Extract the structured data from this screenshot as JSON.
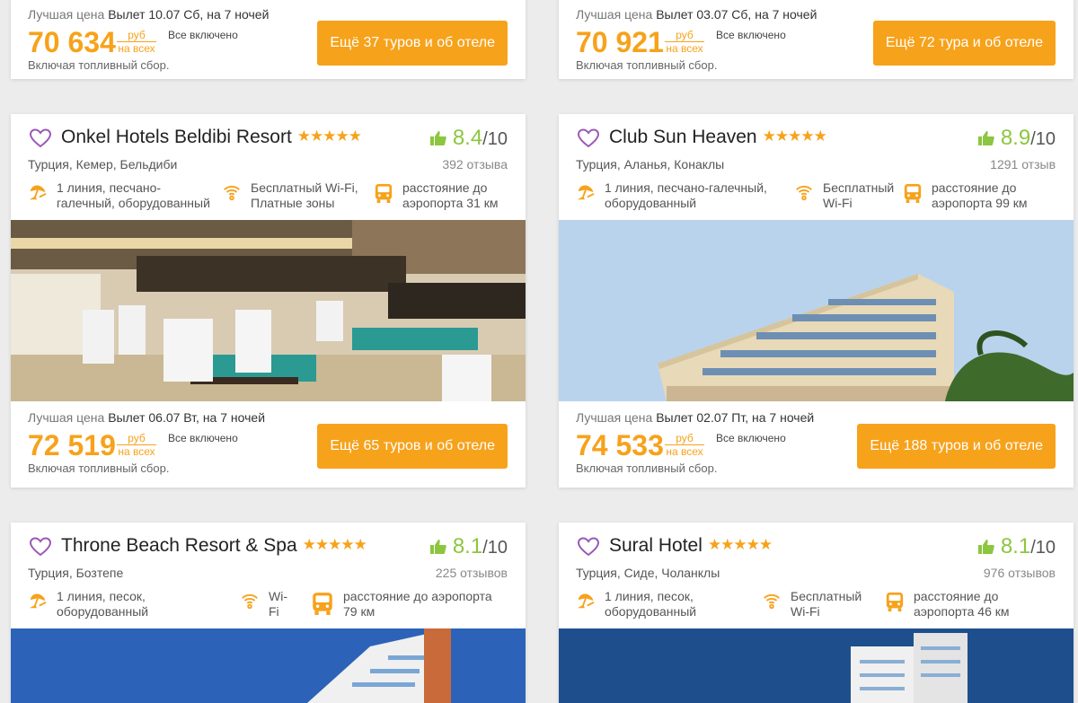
{
  "labels": {
    "best_price": "Лучшая цена",
    "fuel": "Включая топливный сбор.",
    "currency_top": "руб",
    "currency_bottom": "на всех"
  },
  "top_row": [
    {
      "departure": "Вылет 10.07 Сб, на 7 ночей",
      "price": "70 634",
      "meal": "Все включено",
      "tours_btn": "Ещё 37 туров и об отеле"
    },
    {
      "departure": "Вылет 03.07 Сб, на 7 ночей",
      "price": "70 921",
      "meal": "Все включено",
      "tours_btn": "Ещё 72 тура и об отеле"
    }
  ],
  "hotels": [
    {
      "name": "Onkel Hotels Beldibi Resort",
      "stars": "★★★★★",
      "rating": "8.4",
      "rating_max": "/10",
      "location": "Турция, Кемер, Бельдиби",
      "reviews": "392 отзыва",
      "beach": "1 линия, песчано-галечный, оборудованный",
      "wifi": "Бесплатный Wi-Fi, Платные зоны",
      "airport": "расстояние до аэропорта 31 км",
      "departure": "Вылет 06.07 Вт, на 7 ночей",
      "price": "72 519",
      "meal": "Все включено",
      "tours_btn": "Ещё 65 туров и об отеле"
    },
    {
      "name": "Club Sun Heaven",
      "stars": "★★★★★",
      "rating": "8.9",
      "rating_max": "/10",
      "location": "Турция, Аланья, Конаклы",
      "reviews": "1291 отзыв",
      "beach": "1 линия, песчано-галечный, оборудованный",
      "wifi": "Бесплатный Wi-Fi",
      "airport": "расстояние до аэропорта 99 км",
      "departure": "Вылет 02.07 Пт, на 7 ночей",
      "price": "74 533",
      "meal": "Все включено",
      "tours_btn": "Ещё 188 туров и об отеле"
    },
    {
      "name": "Throne Beach Resort & Spa",
      "stars": "★★★★★",
      "rating": "8.1",
      "rating_max": "/10",
      "location": "Турция, Бозтепе",
      "reviews": "225 отзывов",
      "beach": "1 линия, песок, оборудованный",
      "wifi": "Wi-Fi",
      "airport": "расстояние до аэропорта 79 км"
    },
    {
      "name": "Sural Hotel",
      "stars": "★★★★★",
      "rating": "8.1",
      "rating_max": "/10",
      "location": "Турция, Сиде, Чоланклы",
      "reviews": "976 отзывов",
      "beach": "1 линия, песок, оборудованный",
      "wifi": "Бесплатный Wi-Fi",
      "airport": "расстояние до аэропорта 46 км"
    }
  ],
  "colors": {
    "accent": "#f7a21b",
    "rating": "#8cc63f",
    "heart": "#9b59b6"
  }
}
